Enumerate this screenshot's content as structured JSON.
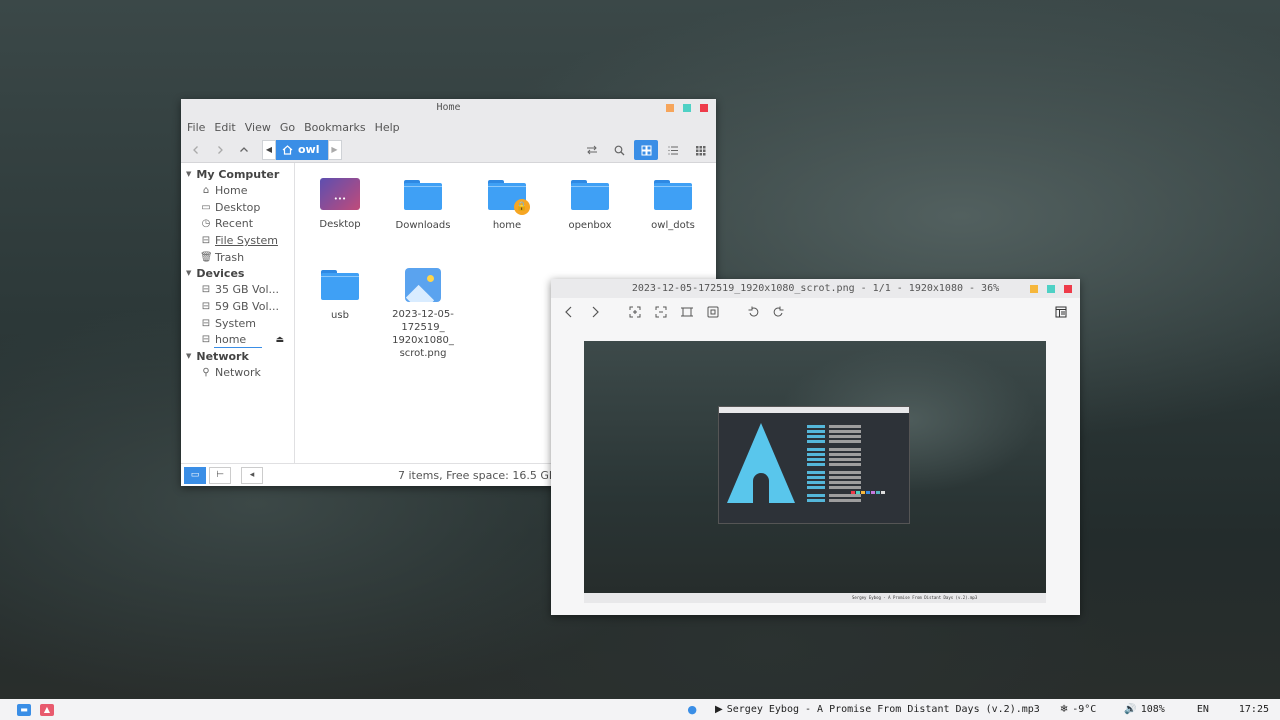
{
  "file_manager": {
    "title": "Home",
    "menu": [
      "File",
      "Edit",
      "View",
      "Go",
      "Bookmarks",
      "Help"
    ],
    "breadcrumb": "owl",
    "sidebar": {
      "my_computer": {
        "heading": "My Computer",
        "items": [
          "Home",
          "Desktop",
          "Recent",
          "File System",
          "Trash"
        ]
      },
      "devices": {
        "heading": "Devices",
        "items": [
          "35 GB Vol...",
          "59 GB Vol...",
          "System",
          "home"
        ]
      },
      "network": {
        "heading": "Network",
        "items": [
          "Network"
        ]
      }
    },
    "files": [
      {
        "name": "Desktop",
        "type": "desktop"
      },
      {
        "name": "Downloads",
        "type": "folder"
      },
      {
        "name": "home",
        "type": "folder-locked"
      },
      {
        "name": "openbox",
        "type": "folder"
      },
      {
        "name": "owl_dots",
        "type": "folder"
      },
      {
        "name": "usb",
        "type": "folder"
      },
      {
        "name": "2023-12-05-172519_1920x1080_scrot.png",
        "type": "image",
        "display_lines": [
          "2023-12-05-",
          "172519_",
          "1920x1080_",
          "scrot.png"
        ]
      }
    ],
    "status": "7 items, Free space: 16.5 GB"
  },
  "image_viewer": {
    "title": "2023-12-05-172519_1920x1080_scrot.png - 1/1 - 1920x1080 - 36%",
    "thumb_taskbar_text": "Sergey Eybog - A Promise From Distant Days (v.2).mp3"
  },
  "taskbar": {
    "now_playing": "Sergey Eybog - A Promise From Distant Days (v.2).mp3",
    "weather": "-9°C",
    "volume": "108%",
    "layout": "EN",
    "time": "17:25"
  },
  "colors": {
    "accent": "#3a8ee6",
    "close": "#ee3b4a",
    "maximize": "#4fd1c5",
    "minimize": "#f6a55b",
    "folder": "#3fa0f5"
  }
}
